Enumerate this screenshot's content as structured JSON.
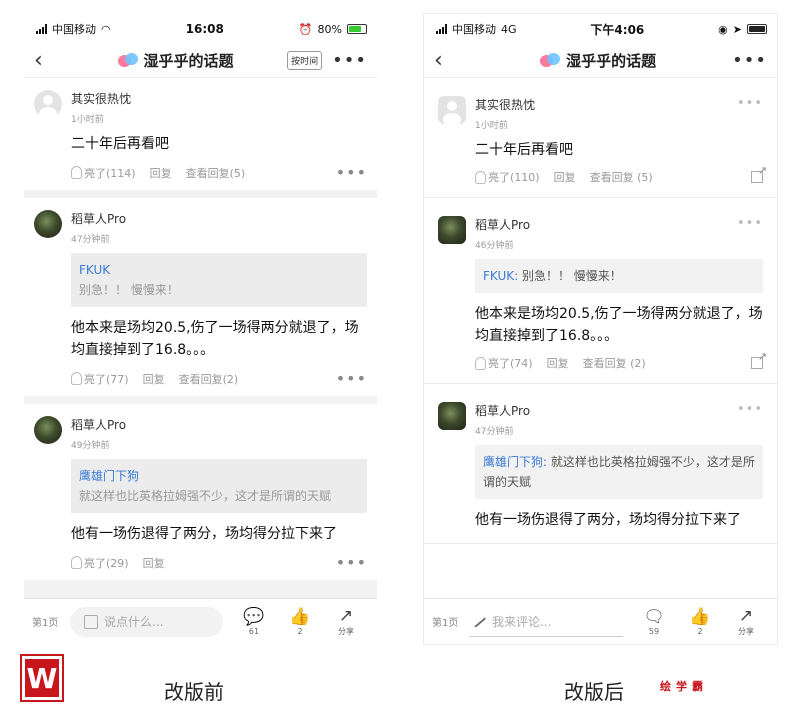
{
  "left": {
    "status": {
      "carrier": "中国移动",
      "time": "16:08",
      "battery": "80%"
    },
    "nav": {
      "back": "‹",
      "title": "湿乎乎的话题",
      "sort": "按时间",
      "more": "•••"
    },
    "comments": [
      {
        "name": "其实很热忱",
        "time": "1小时前",
        "text": "二十年后再看吧",
        "like": "亮了(114)",
        "reply": "回复",
        "view": "查看回复(5)"
      },
      {
        "name": "稻草人Pro",
        "time": "47分钟前",
        "quote_user": "FKUK",
        "quote_text": "别急！！ 慢慢来！",
        "text": "他本来是场均20.5,伤了一场得两分就退了，场均直接掉到了16.8。。。",
        "like": "亮了(77)",
        "reply": "回复",
        "view": "查看回复(2)"
      },
      {
        "name": "稻草人Pro",
        "time": "49分钟前",
        "quote_user": "鹰雄门下狗",
        "quote_text": "就这样也比英格拉姆强不少，这才是所谓的天赋",
        "text": "他有一场伤退得了两分，场均得分拉下来了",
        "like": "亮了(29)",
        "reply": "回复",
        "view": ""
      }
    ],
    "bottom": {
      "page": "第1页",
      "placeholder": "说点什么...",
      "comments_count": "61",
      "likes_count": "2",
      "share": "分享"
    }
  },
  "right": {
    "status": {
      "carrier": "中国移动",
      "network": "4G",
      "time": "下午4:06"
    },
    "nav": {
      "back": "‹",
      "title": "湿乎乎的话题",
      "more": "•••"
    },
    "comments": [
      {
        "name": "其实很热忱",
        "time": "1小时前",
        "text": "二十年后再看吧",
        "like": "亮了(110)",
        "reply": "回复",
        "view": "查看回复 (5)"
      },
      {
        "name": "稻草人Pro",
        "time": "46分钟前",
        "quote_user": "FKUK:",
        "quote_text": "别急！！ 慢慢来！",
        "text": "他本来是场均20.5,伤了一场得两分就退了，场均直接掉到了16.8。。。",
        "like": "亮了(74)",
        "reply": "回复",
        "view": "查看回复 (2)"
      },
      {
        "name": "稻草人Pro",
        "time": "47分钟前",
        "quote_user": "鹰雄门下狗:",
        "quote_text": "就这样也比英格拉姆强不少，这才是所谓的天赋",
        "text": "他有一场伤退得了两分，场均得分拉下来了",
        "like": "",
        "reply": "",
        "view": ""
      }
    ],
    "bottom": {
      "page": "第1页",
      "placeholder": "我来评论...",
      "comments_count": "59",
      "likes_count": "2",
      "share": "分享"
    }
  },
  "captions": {
    "before": "改版前",
    "after": "改版后",
    "watermark": "绘学霸"
  }
}
